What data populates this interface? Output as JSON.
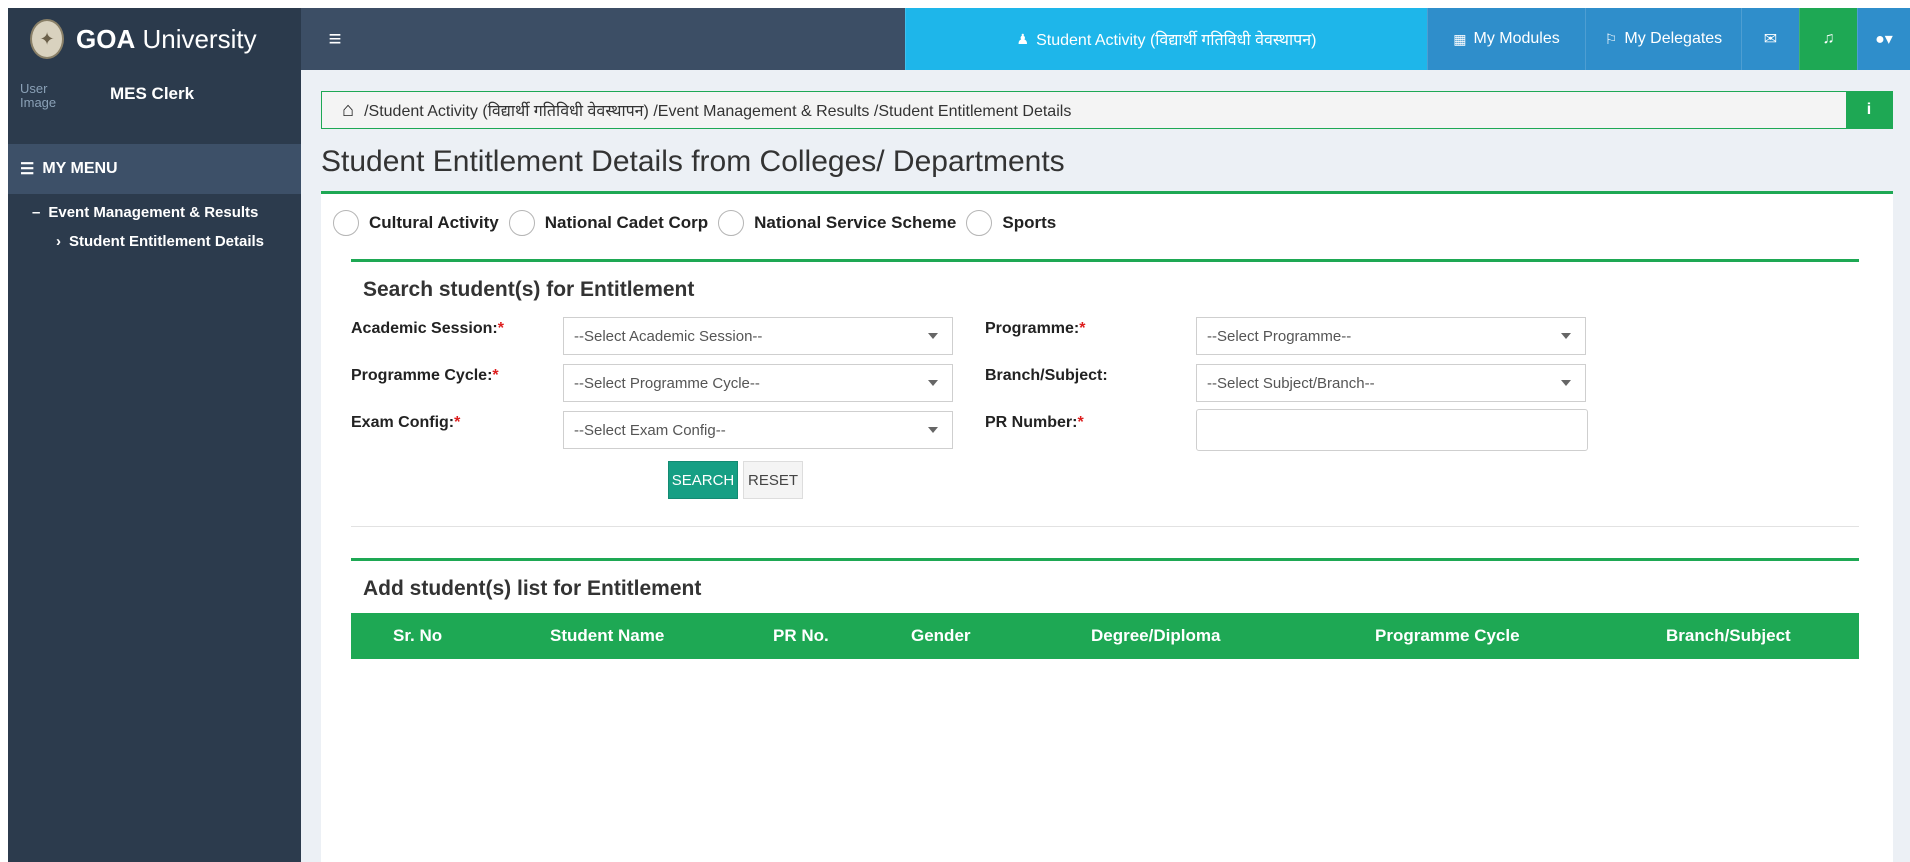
{
  "app": {
    "title_bold": "GOA",
    "title_rest": " University"
  },
  "navbar": {
    "activity_label": "Student Activity (विद्यार्थी गतिविधी वेवस्थापन)",
    "modules_label": "My Modules",
    "delegates_label": "My Delegates"
  },
  "sidebar": {
    "user_image_alt": "User Image",
    "user_name": "MES Clerk",
    "menu_header": "MY MENU",
    "group_label": "Event Management & Results",
    "sub_item_label": "Student Entitlement Details"
  },
  "breadcrumb": {
    "path": "/Student Activity (विद्यार्थी गतिविधी वेवस्थापन) /Event Management & Results /Student Entitlement Details"
  },
  "page": {
    "title": "Student Entitlement Details from Colleges/ Departments"
  },
  "activity_types": [
    "Cultural Activity",
    "National Cadet Corp",
    "National Service Scheme",
    "Sports"
  ],
  "search": {
    "section_title": "Search student(s) for Entitlement",
    "fields": {
      "academic_session": {
        "label": "Academic Session:",
        "placeholder": "--Select Academic Session--"
      },
      "programme": {
        "label": "Programme:",
        "placeholder": "--Select Programme--"
      },
      "programme_cycle": {
        "label": "Programme Cycle:",
        "placeholder": "--Select Programme Cycle--"
      },
      "branch_subject": {
        "label": "Branch/Subject:",
        "placeholder": "--Select Subject/Branch--"
      },
      "exam_config": {
        "label": "Exam Config:",
        "placeholder": "--Select Exam Config--"
      },
      "pr_number": {
        "label": "PR Number:",
        "value": ""
      }
    },
    "required_mark": "*",
    "search_button": "SEARCH",
    "reset_button": "RESET"
  },
  "results": {
    "section_title": "Add student(s) list for Entitlement",
    "columns": [
      "Sr. No",
      "Student Name",
      "PR No.",
      "Gender",
      "Degree/Diploma",
      "Programme Cycle",
      "Branch/Subject"
    ],
    "rows": []
  },
  "colors": {
    "accent_green": "#1ea854",
    "sidebar": "#2c3b4d",
    "navbar": "#3c4e65",
    "activity_tab": "#1eb6ea",
    "nav_blue": "#2f8ecb",
    "search_button": "#169f84"
  },
  "icons": {
    "hamburger": "hamburger-icon",
    "activity": "student-icon",
    "modules": "grid-icon",
    "delegates": "flag-icon",
    "mail": "envelope-icon",
    "bell": "bell-icon",
    "user": "user-icon",
    "menu": "list-icon",
    "home": "home-icon",
    "info": "info-icon"
  }
}
